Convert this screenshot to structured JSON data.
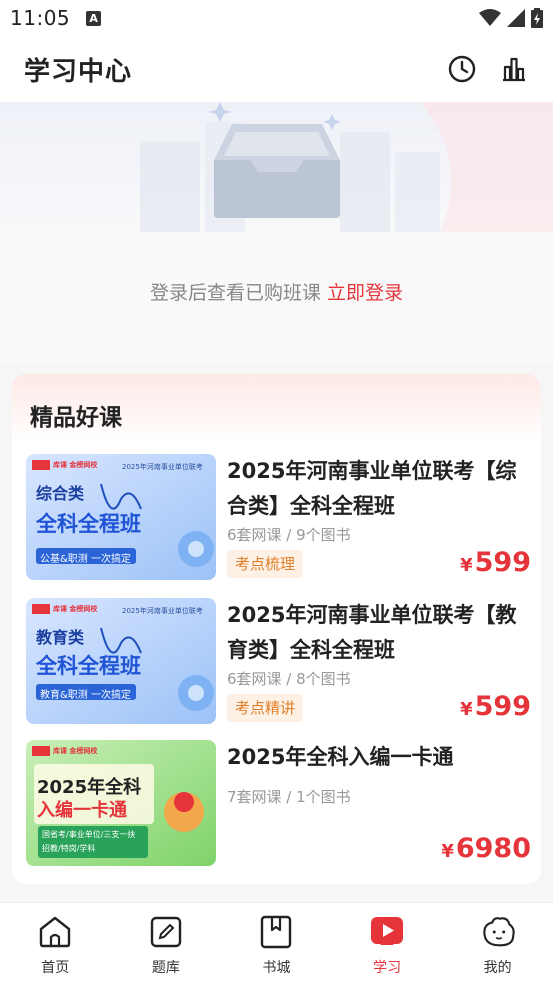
{
  "status_bar": {
    "time": "11:05",
    "notif_letter": "A"
  },
  "header": {
    "title": "学习中心",
    "history_icon": "clock-icon",
    "stats_icon": "bar-chart-icon"
  },
  "empty_state": {
    "message": "登录后查看已购班课",
    "login_link": "立即登录",
    "illustration": "empty-box-illustration"
  },
  "courses": {
    "section_title": "精品好课",
    "items": [
      {
        "title": "2025年河南事业单位联考【综合类】全科全程班",
        "meta": "6套网课 / 9个图书",
        "tag": "考点梳理",
        "currency": "¥",
        "price": "599",
        "thumb": {
          "brand": "库课 金榜网校",
          "exam": "2025年河南事业单位联考",
          "category": "综合类",
          "headline": "全科全程班",
          "slogan": "公基&职测 一次搞定"
        }
      },
      {
        "title": "2025年河南事业单位联考【教育类】全科全程班",
        "meta": "6套网课 / 8个图书",
        "tag": "考点精讲",
        "currency": "¥",
        "price": "599",
        "thumb": {
          "brand": "库课 金榜网校",
          "exam": "2025年河南事业单位联考",
          "category": "教育类",
          "headline": "全科全程班",
          "slogan": "教育&职测 一次搞定"
        }
      },
      {
        "title": "2025年全科入编一卡通",
        "meta": "7套网课 / 1个图书",
        "tag": "",
        "currency": "¥",
        "price": "6980",
        "thumb": {
          "brand": "库课 金榜网校",
          "line1": "2025年全科",
          "line2": "入编一卡通",
          "sub1": "国省考/事业单位/三支一扶",
          "sub2": "招教/特岗/学科"
        }
      }
    ]
  },
  "tab_bar": {
    "tabs": [
      {
        "label": "首页",
        "icon": "home-icon",
        "active": false
      },
      {
        "label": "题库",
        "icon": "edit-icon",
        "active": false
      },
      {
        "label": "书城",
        "icon": "bookmark-icon",
        "active": false
      },
      {
        "label": "学习",
        "icon": "play-icon",
        "active": true
      },
      {
        "label": "我的",
        "icon": "mascot-icon",
        "active": false
      }
    ]
  },
  "colors": {
    "accent": "#e5343a",
    "tag_bg": "#fdf0e4",
    "tag_text": "#e0802a"
  }
}
